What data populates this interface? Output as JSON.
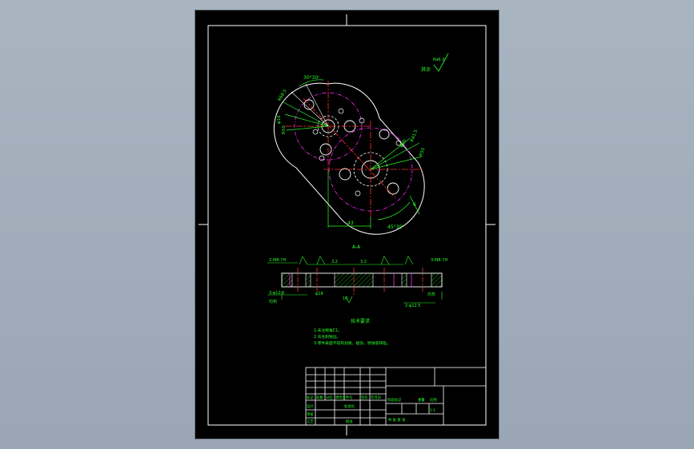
{
  "drawing": {
    "section_label": "A-A",
    "tech_requirements_title": "技术要求",
    "tech_requirements": [
      "1.未注倒角C1。",
      "2.去毛刺锐边。",
      "3.零件表面不得有划痕、碰伤、锈蚀等缺陷。"
    ],
    "roughness_note": "其余",
    "roughness_value": "Ra6.3"
  },
  "dimensions": {
    "angle_top": "30°30'",
    "angle_bottom": "45°30'",
    "dim_left_1": "R68.5",
    "dim_left_2": "φ16",
    "dim_left_3": "R50",
    "dim_right_1": "R41.5",
    "dim_right_2": "R50",
    "dim_right_3": "φ20",
    "dim_bottom": "43",
    "dim_right_side": "6",
    "sec_left_note": "2-M8-7H",
    "sec_right_note": "3-M8-7H",
    "sec_left_bottom": "3-φ12.5",
    "sec_right_bottom": "2-φ12.5",
    "sec_center_1": "3.2",
    "sec_center_2": "3.2",
    "sec_bottom_center": "φ18",
    "sec_bottom_center_2": "10",
    "sec_left_label": "均布",
    "sec_right_label": "均布"
  },
  "title_block": {
    "row_header": [
      "标记",
      "处数",
      "分区",
      "更改文件号",
      "签名",
      "年月日"
    ],
    "designer_label": "设计",
    "standard_label": "标准化",
    "review_label": "审核",
    "process_label": "工艺",
    "approve_label": "批准",
    "stage_label": "阶段标记",
    "weight_label": "重量",
    "scale_label": "比例",
    "scale_value": "1:1",
    "sheets_label": "共  张  第  张"
  },
  "colors": {
    "line_white": "#ffffff",
    "line_green": "#29ff29",
    "line_magenta": "#ff2bff",
    "line_red": "#ff3030",
    "line_cyan": "#30e0ff",
    "hatch": "#29ff29"
  }
}
